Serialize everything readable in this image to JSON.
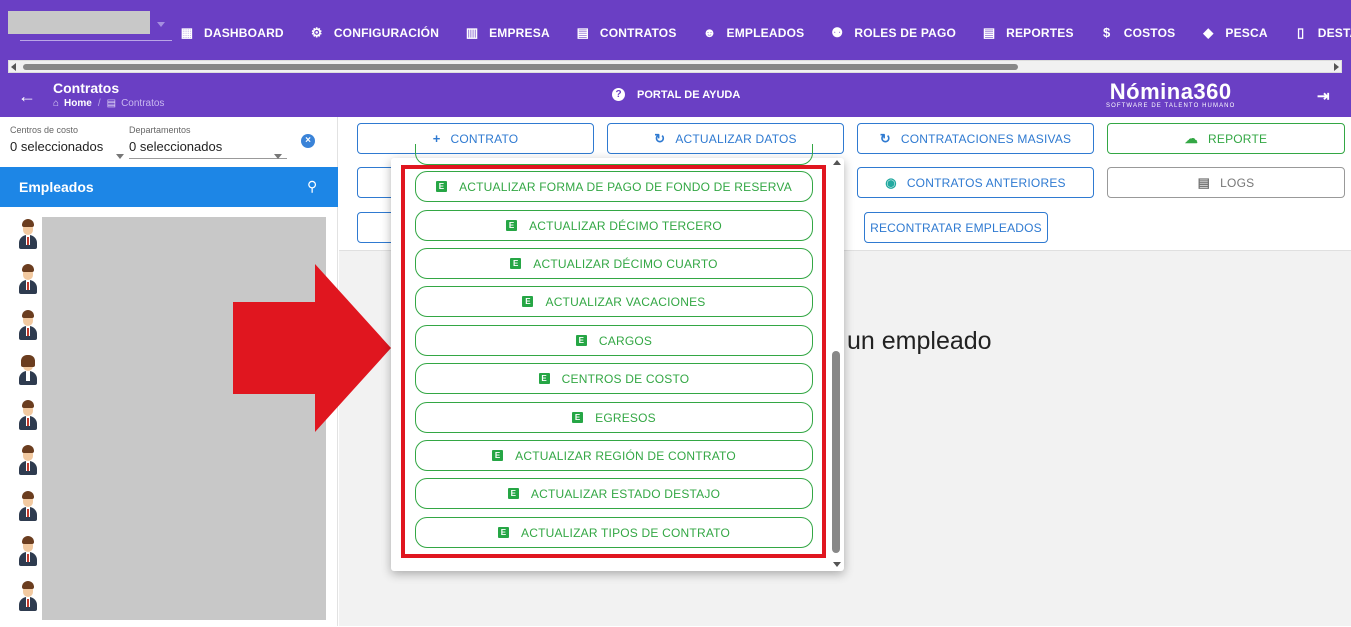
{
  "nav": {
    "items": [
      {
        "label": "DASHBOARD",
        "icon": "dashboard-icon"
      },
      {
        "label": "CONFIGURACIÓN",
        "icon": "gear-icon"
      },
      {
        "label": "EMPRESA",
        "icon": "building-icon"
      },
      {
        "label": "CONTRATOS",
        "icon": "clipboard-icon"
      },
      {
        "label": "EMPLEADOS",
        "icon": "face-icon"
      },
      {
        "label": "ROLES DE PAGO",
        "icon": "people-icon"
      },
      {
        "label": "REPORTES",
        "icon": "clipboard-icon"
      },
      {
        "label": "COSTOS",
        "icon": "invoice-icon"
      },
      {
        "label": "PESCA",
        "icon": "fish-icon"
      },
      {
        "label": "DESTAJO",
        "icon": "document-icon"
      }
    ]
  },
  "header": {
    "title": "Contratos",
    "breadcrumb_home": "Home",
    "breadcrumb_current": "Contratos",
    "help_label": "PORTAL DE AYUDA",
    "logo_main": "Nómina360",
    "logo_tagline": "SOFTWARE DE TALENTO HUMANO"
  },
  "filters": {
    "centros_label": "Centros de costo",
    "centros_value": "0 seleccionados",
    "departamentos_label": "Departamentos",
    "departamentos_value": "0 seleccionados"
  },
  "employees": {
    "title": "Empleados"
  },
  "toolbar": {
    "contrato": "CONTRATO",
    "actualizar_datos": "ACTUALIZAR DATOS",
    "contrataciones_masivas": "CONTRATACIONES MASIVAS",
    "reporte": "REPORTE",
    "contratos_anteriores": "CONTRATOS ANTERIORES",
    "logs": "LOGS",
    "recontratar": "RECONTRATAR EMPLEADOS"
  },
  "main": {
    "background_text": "un empleado"
  },
  "dropdown": {
    "items": [
      "ACTUALIZAR FORMA DE PAGO DE FONDO DE RESERVA",
      "ACTUALIZAR DÉCIMO TERCERO",
      "ACTUALIZAR DÉCIMO CUARTO",
      "ACTUALIZAR VACACIONES",
      "CARGOS",
      "CENTROS DE COSTO",
      "EGRESOS",
      "ACTUALIZAR REGIÓN DE CONTRATO",
      "ACTUALIZAR ESTADO DESTAJO",
      "ACTUALIZAR TIPOS DE CONTRATO"
    ],
    "item_icon_letter": "E"
  },
  "colors": {
    "primary": "#6a3fc4",
    "blue": "#1d86e6",
    "green": "#33a744",
    "highlight": "#e0161f"
  }
}
